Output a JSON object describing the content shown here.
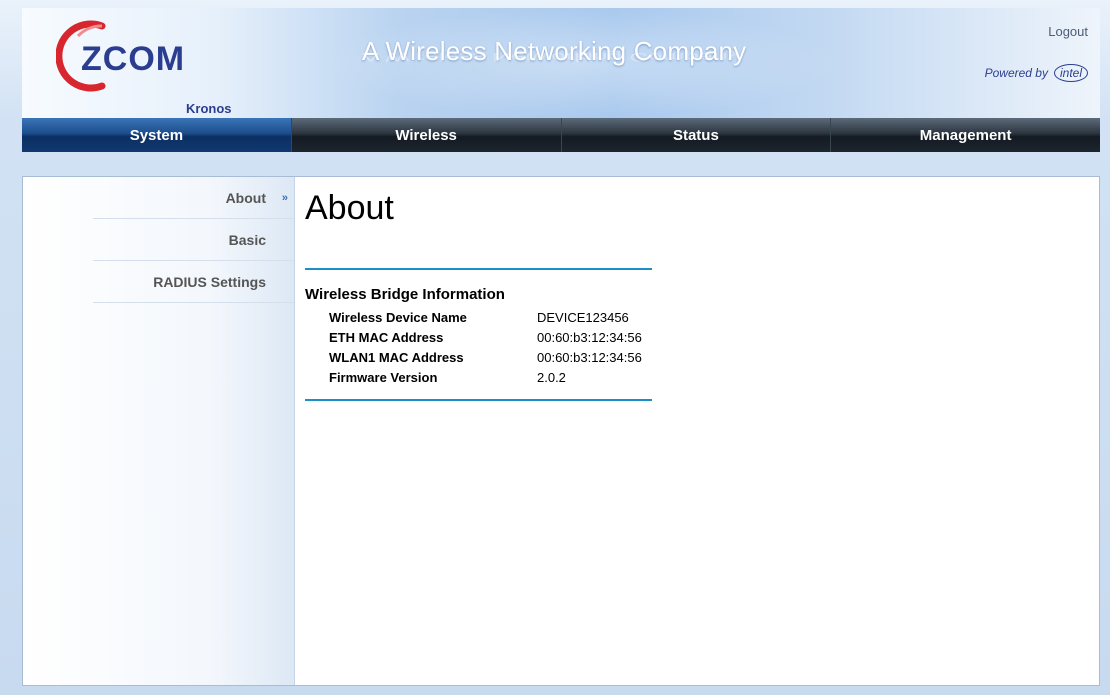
{
  "header": {
    "logo_text": "ZCOM",
    "logo_sub": "Kronos",
    "tagline": "A Wireless Networking Company",
    "logout_label": "Logout",
    "powered_by": "Powered by",
    "powered_brand": "intel"
  },
  "nav": {
    "items": [
      {
        "label": "System",
        "active": true
      },
      {
        "label": "Wireless",
        "active": false
      },
      {
        "label": "Status",
        "active": false
      },
      {
        "label": "Management",
        "active": false
      }
    ]
  },
  "sidebar": {
    "items": [
      {
        "label": "About",
        "active": true,
        "arrow": "»"
      },
      {
        "label": "Basic",
        "active": false
      },
      {
        "label": "RADIUS Settings",
        "active": false
      }
    ]
  },
  "main": {
    "title": "About",
    "section_heading": "Wireless Bridge Information",
    "rows": [
      {
        "label": "Wireless Device Name",
        "value": "DEVICE123456"
      },
      {
        "label": "ETH MAC Address",
        "value": "00:60:b3:12:34:56"
      },
      {
        "label": "WLAN1 MAC Address",
        "value": "00:60:b3:12:34:56"
      },
      {
        "label": "Firmware Version",
        "value": "2.0.2"
      }
    ]
  },
  "colors": {
    "accent_blue": "#1c8fc9",
    "brand_navy": "#2b3d8f",
    "logo_red": "#d8262e"
  }
}
